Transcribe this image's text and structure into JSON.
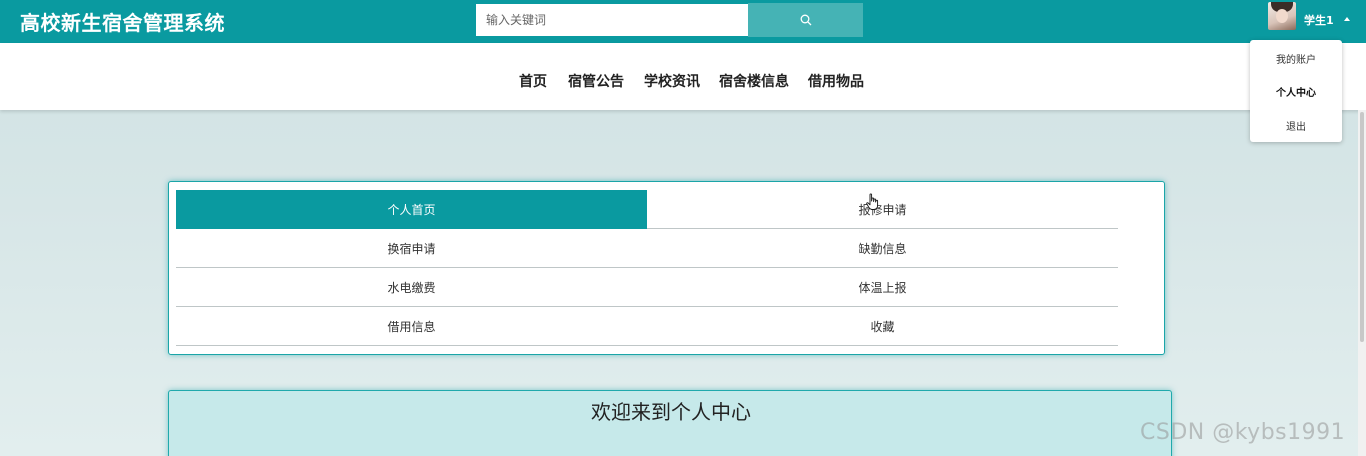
{
  "header": {
    "app_title": "高校新生宿舍管理系统",
    "search_placeholder": "输入关键词",
    "search_value": "",
    "username": "学生1"
  },
  "nav": {
    "items": [
      {
        "label": "首页"
      },
      {
        "label": "宿管公告"
      },
      {
        "label": "学校资讯"
      },
      {
        "label": "宿舍楼信息"
      },
      {
        "label": "借用物品"
      }
    ]
  },
  "user_menu": {
    "items": [
      {
        "label": "我的账户"
      },
      {
        "label": "个人中心"
      },
      {
        "label": "退出"
      }
    ],
    "active": "个人中心"
  },
  "center_menu": {
    "items": [
      {
        "label": "个人首页"
      },
      {
        "label": "报修申请"
      },
      {
        "label": "换宿申请"
      },
      {
        "label": "缺勤信息"
      },
      {
        "label": "水电缴费"
      },
      {
        "label": "体温上报"
      },
      {
        "label": "借用信息"
      },
      {
        "label": "收藏"
      }
    ],
    "active": "个人首页"
  },
  "welcome": {
    "title": "欢迎来到个人中心"
  },
  "watermark": "CSDN @kybs1991",
  "colors": {
    "primary": "#0a9aa0",
    "search_button": "#45b3b5",
    "welcome_bg": "#c6e9ea"
  }
}
